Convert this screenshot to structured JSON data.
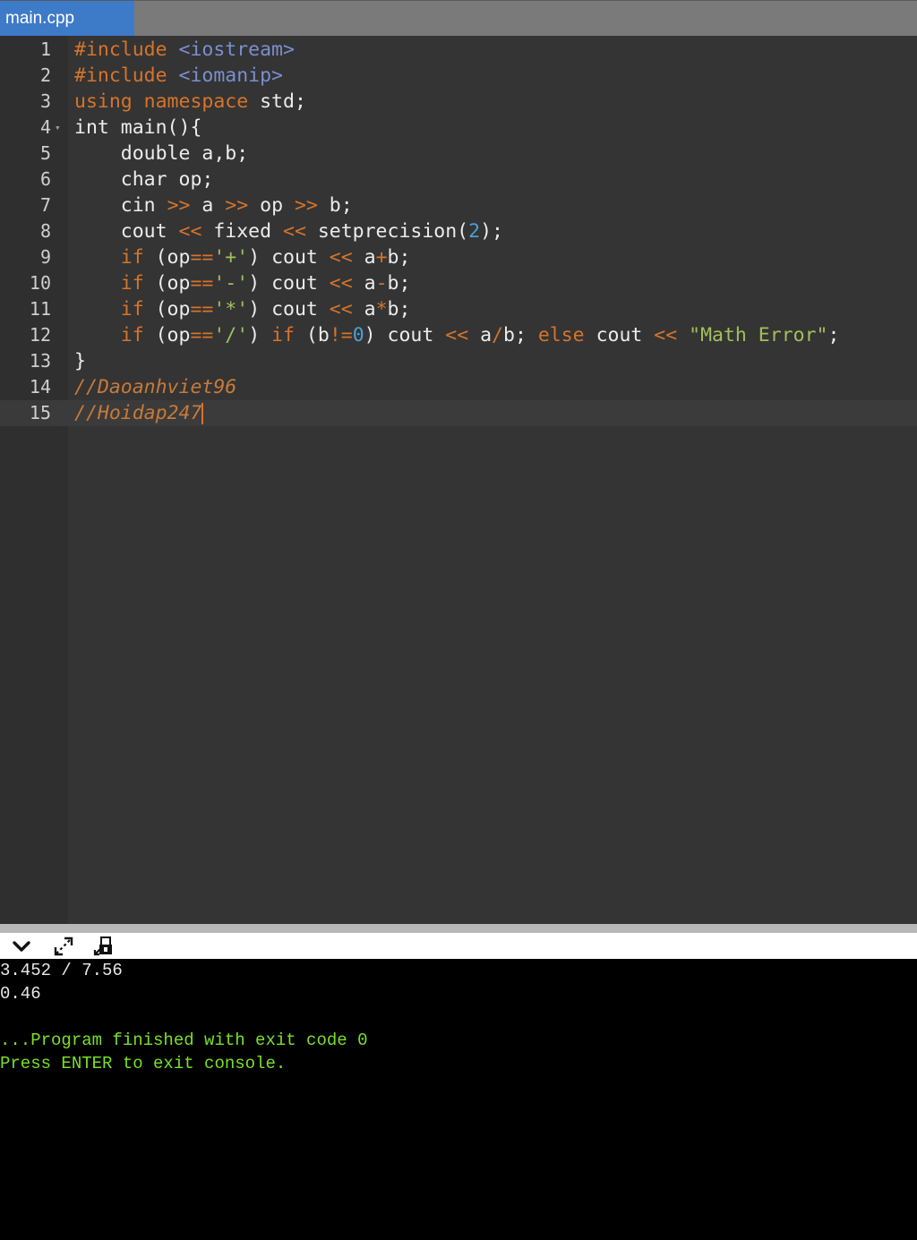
{
  "tab": {
    "label": "main.cpp"
  },
  "editor": {
    "lines": [
      {
        "n": "1",
        "tokens": [
          {
            "c": "t-kw",
            "t": "#include "
          },
          {
            "c": "t-ang",
            "t": "<iostream>"
          }
        ]
      },
      {
        "n": "2",
        "tokens": [
          {
            "c": "t-kw",
            "t": "#include "
          },
          {
            "c": "t-ang",
            "t": "<iomanip>"
          }
        ]
      },
      {
        "n": "3",
        "tokens": [
          {
            "c": "t-kw",
            "t": "using namespace"
          },
          {
            "c": "t-pl",
            "t": " std;"
          }
        ]
      },
      {
        "n": "4",
        "fold": true,
        "tokens": [
          {
            "c": "t-pl",
            "t": "int main(){"
          }
        ]
      },
      {
        "n": "5",
        "tokens": [
          {
            "c": "t-pl",
            "t": "    double a,b;"
          }
        ]
      },
      {
        "n": "6",
        "tokens": [
          {
            "c": "t-pl",
            "t": "    char op;"
          }
        ]
      },
      {
        "n": "7",
        "tokens": [
          {
            "c": "t-pl",
            "t": "    cin "
          },
          {
            "c": "t-kw",
            "t": ">>"
          },
          {
            "c": "t-pl",
            "t": " a "
          },
          {
            "c": "t-kw",
            "t": ">>"
          },
          {
            "c": "t-pl",
            "t": " op "
          },
          {
            "c": "t-kw",
            "t": ">>"
          },
          {
            "c": "t-pl",
            "t": " b;"
          }
        ]
      },
      {
        "n": "8",
        "tokens": [
          {
            "c": "t-pl",
            "t": "    cout "
          },
          {
            "c": "t-kw",
            "t": "<<"
          },
          {
            "c": "t-pl",
            "t": " fixed "
          },
          {
            "c": "t-kw",
            "t": "<<"
          },
          {
            "c": "t-pl",
            "t": " setprecision("
          },
          {
            "c": "t-num",
            "t": "2"
          },
          {
            "c": "t-pl",
            "t": ");"
          }
        ]
      },
      {
        "n": "9",
        "tokens": [
          {
            "c": "t-kw",
            "t": "    if"
          },
          {
            "c": "t-pl",
            "t": " (op"
          },
          {
            "c": "t-kw",
            "t": "=="
          },
          {
            "c": "t-str",
            "t": "'+'"
          },
          {
            "c": "t-pl",
            "t": ") cout "
          },
          {
            "c": "t-kw",
            "t": "<<"
          },
          {
            "c": "t-pl",
            "t": " a"
          },
          {
            "c": "t-kw",
            "t": "+"
          },
          {
            "c": "t-pl",
            "t": "b;"
          }
        ]
      },
      {
        "n": "10",
        "tokens": [
          {
            "c": "t-kw",
            "t": "    if"
          },
          {
            "c": "t-pl",
            "t": " (op"
          },
          {
            "c": "t-kw",
            "t": "=="
          },
          {
            "c": "t-str",
            "t": "'-'"
          },
          {
            "c": "t-pl",
            "t": ") cout "
          },
          {
            "c": "t-kw",
            "t": "<<"
          },
          {
            "c": "t-pl",
            "t": " a"
          },
          {
            "c": "t-kw",
            "t": "-"
          },
          {
            "c": "t-pl",
            "t": "b;"
          }
        ]
      },
      {
        "n": "11",
        "tokens": [
          {
            "c": "t-kw",
            "t": "    if"
          },
          {
            "c": "t-pl",
            "t": " (op"
          },
          {
            "c": "t-kw",
            "t": "=="
          },
          {
            "c": "t-str",
            "t": "'*'"
          },
          {
            "c": "t-pl",
            "t": ") cout "
          },
          {
            "c": "t-kw",
            "t": "<<"
          },
          {
            "c": "t-pl",
            "t": " a"
          },
          {
            "c": "t-kw",
            "t": "*"
          },
          {
            "c": "t-pl",
            "t": "b;"
          }
        ]
      },
      {
        "n": "12",
        "tokens": [
          {
            "c": "t-kw",
            "t": "    if"
          },
          {
            "c": "t-pl",
            "t": " (op"
          },
          {
            "c": "t-kw",
            "t": "=="
          },
          {
            "c": "t-str",
            "t": "'/'"
          },
          {
            "c": "t-pl",
            "t": ") "
          },
          {
            "c": "t-kw",
            "t": "if"
          },
          {
            "c": "t-pl",
            "t": " (b"
          },
          {
            "c": "t-kw",
            "t": "!="
          },
          {
            "c": "t-num",
            "t": "0"
          },
          {
            "c": "t-pl",
            "t": ") cout "
          },
          {
            "c": "t-kw",
            "t": "<<"
          },
          {
            "c": "t-pl",
            "t": " a"
          },
          {
            "c": "t-kw",
            "t": "/"
          },
          {
            "c": "t-pl",
            "t": "b; "
          },
          {
            "c": "t-kw",
            "t": "else"
          },
          {
            "c": "t-pl",
            "t": " cout "
          },
          {
            "c": "t-kw",
            "t": "<<"
          },
          {
            "c": "t-pl",
            "t": " "
          },
          {
            "c": "t-str",
            "t": "\"Math Error\""
          },
          {
            "c": "t-pl",
            "t": ";"
          }
        ]
      },
      {
        "n": "13",
        "tokens": [
          {
            "c": "t-pl",
            "t": "}"
          }
        ]
      },
      {
        "n": "14",
        "tokens": [
          {
            "c": "t-cmt",
            "t": "//Daoanhviet96"
          }
        ]
      },
      {
        "n": "15",
        "active": true,
        "cursor": true,
        "tokens": [
          {
            "c": "t-cmt",
            "t": "//Hoidap247"
          }
        ]
      }
    ]
  },
  "toolbar": {
    "icons": [
      "chevron-down-icon",
      "expand-icon",
      "lock-copy-icon"
    ]
  },
  "console": {
    "input": "3.452 / 7.56",
    "output": "0.46",
    "blank": "",
    "finished": "...Program finished with exit code 0",
    "press_enter": "Press ENTER to exit console."
  },
  "colors": {
    "tab_active": "#3d7ac8",
    "keyword": "#d6742b",
    "string": "#a2c05a",
    "number": "#4aa0d8",
    "console_success": "#78e028"
  }
}
